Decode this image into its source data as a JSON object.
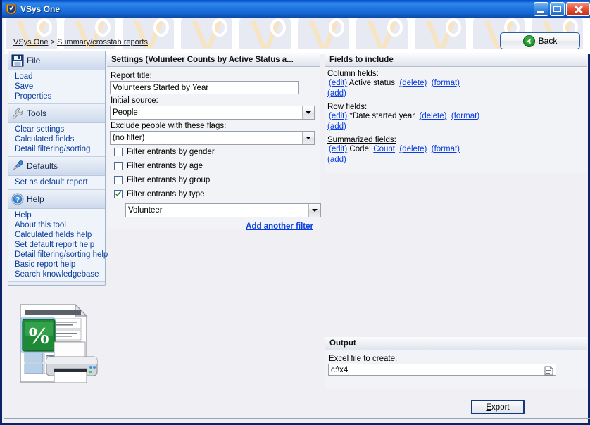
{
  "window": {
    "title": "VSys One",
    "app_icon": "vsys-shield-icon",
    "minimize_label": "Minimize",
    "maximize_label": "Maximize",
    "close_label": "Close"
  },
  "header": {
    "breadcrumb": {
      "root": "VSys One",
      "separator": ">",
      "current": "Summary/crosstab reports"
    },
    "back_button": {
      "label": "Back",
      "icon": "back-arrow-icon"
    }
  },
  "sidebar": {
    "groups": [
      {
        "name": "File",
        "icon": "floppy-disk-icon",
        "links": [
          "Load",
          "Save",
          "Properties"
        ]
      },
      {
        "name": "Tools",
        "icon": "wrench-icon",
        "links": [
          "Clear settings",
          "Calculated fields",
          "Detail filtering/sorting"
        ]
      },
      {
        "name": "Defaults",
        "icon": "pushpin-icon",
        "links": [
          "Set as default report"
        ]
      },
      {
        "name": "Help",
        "icon": "question-mark-icon",
        "links": [
          "Help",
          "About this tool",
          "Calculated fields help",
          "Set default report help",
          "Detail filtering/sorting help",
          "Basic report help",
          "Search knowledgebase"
        ]
      }
    ],
    "artwork_icon": "excel-report-printer-icon"
  },
  "settings": {
    "panel_title": "Settings (Volunteer Counts by Active Status a...",
    "report_title_label": "Report title:",
    "report_title_value": "Volunteers Started by Year",
    "initial_source_label": "Initial source:",
    "initial_source_value": "People",
    "exclude_flags_label": "Exclude people with these flags:",
    "exclude_flags_value": "(no filter)",
    "checkboxes": [
      {
        "label": "Filter entrants by gender",
        "checked": false
      },
      {
        "label": "Filter entrants by age",
        "checked": false
      },
      {
        "label": "Filter entrants by group",
        "checked": false
      },
      {
        "label": "Filter entrants by type",
        "checked": true
      }
    ],
    "type_filter_value": "Volunteer",
    "add_filter_link": "Add another filter"
  },
  "fields": {
    "panel_title": "Fields to include",
    "groups": [
      {
        "title": "Column fields:",
        "edit": "(edit)",
        "name": "Active status",
        "name_is_link": false,
        "delete": "(delete)",
        "format": "(format)",
        "add": "(add)"
      },
      {
        "title": "Row fields:",
        "edit": "(edit)",
        "name": "*Date started year",
        "name_is_link": false,
        "delete": "(delete)",
        "format": "(format)",
        "add": "(add)"
      },
      {
        "title": "Summarized fields:",
        "edit": "(edit)",
        "prefix": "Code:",
        "name": "Count",
        "name_is_link": true,
        "delete": "(delete)",
        "format": "(format)",
        "add": "(add)"
      }
    ]
  },
  "output": {
    "panel_title": "Output",
    "file_label": "Excel file to create:",
    "file_value": "c:\\x4",
    "browse_icon": "file-browse-icon",
    "export_button": {
      "prefix": "E",
      "rest": "xport"
    }
  },
  "colors": {
    "titlebar_blue": "#1f76e0",
    "window_border": "#0a246a",
    "link_blue": "#0b3ee0",
    "sidebar_link": "#0b3e9e",
    "panel_bg": "#f2f3f7",
    "close_red": "#c42d17",
    "back_green": "#1f9428"
  }
}
